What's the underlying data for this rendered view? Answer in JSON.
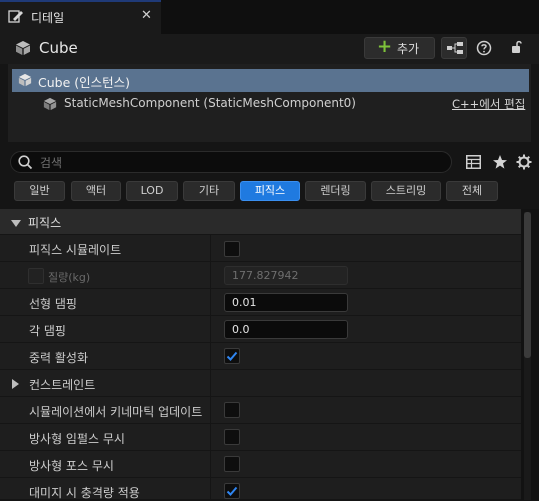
{
  "tab": {
    "title": "디테일",
    "close": "✕"
  },
  "header": {
    "title": "Cube",
    "add_button": "추가",
    "add_plus": "+"
  },
  "tree": {
    "selected": "Cube (인스턴스)",
    "child": "StaticMeshComponent (StaticMeshComponent0)",
    "edit_link": "C++에서 편집"
  },
  "search": {
    "placeholder": "검색"
  },
  "filters": [
    "일반",
    "액터",
    "LOD",
    "기타",
    "피직스",
    "렌더링",
    "스트리밍",
    "전체"
  ],
  "active_filter": "피직스",
  "section": {
    "title": "피직스"
  },
  "properties": [
    {
      "label": "피직스 시뮬레이트",
      "type": "checkbox",
      "checked": false
    },
    {
      "label": "질량(kg)",
      "type": "number",
      "value": "177.827942",
      "disabled": true,
      "checked": false
    },
    {
      "label": "선형 댐핑",
      "type": "number",
      "value": "0.01"
    },
    {
      "label": "각 댐핑",
      "type": "number",
      "value": "0.0"
    },
    {
      "label": "중력 활성화",
      "type": "checkbox",
      "checked": true
    },
    {
      "label": "컨스트레인트",
      "type": "group"
    },
    {
      "label": "시뮬레이션에서 키네마틱 업데이트",
      "type": "checkbox",
      "checked": false
    },
    {
      "label": "방사형 임펄스 무시",
      "type": "checkbox",
      "checked": false
    },
    {
      "label": "방사형 포스 무시",
      "type": "checkbox",
      "checked": false
    },
    {
      "label": "대미지 시 충격량 적용",
      "type": "checkbox",
      "checked": true
    }
  ],
  "colors": {
    "accent": "#1f7ae0",
    "selection": "#5a7390",
    "add_green": "#7ec23a"
  }
}
